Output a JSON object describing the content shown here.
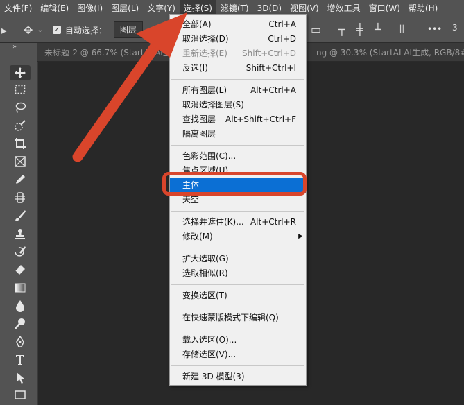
{
  "menubar": {
    "items": [
      "文件(F)",
      "编辑(E)",
      "图像(I)",
      "图层(L)",
      "文字(Y)",
      "选择(S)",
      "滤镜(T)",
      "3D(D)",
      "视图(V)",
      "增效工具",
      "窗口(W)",
      "帮助(H)"
    ],
    "active_index": 5
  },
  "options_bar": {
    "auto_select_label": "自动选择：",
    "layer_select_value": "图层",
    "more_label": "•••"
  },
  "document_tabs": {
    "tab1": "未标题-2 @ 66.7% (StartAI AI生成,",
    "tab2": "ng @ 30.3% (StartAI AI生成, RGB/8#) *"
  },
  "select_menu": {
    "items": [
      {
        "label": "全部(A)",
        "shortcut": "Ctrl+A",
        "disabled": false
      },
      {
        "label": "取消选择(D)",
        "shortcut": "Ctrl+D",
        "disabled": false
      },
      {
        "label": "重新选择(E)",
        "shortcut": "Shift+Ctrl+D",
        "disabled": true
      },
      {
        "label": "反选(I)",
        "shortcut": "Shift+Ctrl+I",
        "disabled": false
      },
      {
        "label": "所有图层(L)",
        "shortcut": "Alt+Ctrl+A",
        "disabled": false
      },
      {
        "label": "取消选择图层(S)",
        "shortcut": "",
        "disabled": false
      },
      {
        "label": "查找图层",
        "shortcut": "Alt+Shift+Ctrl+F",
        "disabled": false
      },
      {
        "label": "隔离图层",
        "shortcut": "",
        "disabled": false
      },
      {
        "label": "色彩范围(C)...",
        "shortcut": "",
        "disabled": false
      },
      {
        "label": "焦点区域(U)...",
        "shortcut": "",
        "disabled": false
      },
      {
        "label": "主体",
        "shortcut": "",
        "disabled": false,
        "highlighted": true
      },
      {
        "label": "天空",
        "shortcut": "",
        "disabled": false
      },
      {
        "label": "选择并遮住(K)...",
        "shortcut": "Alt+Ctrl+R",
        "disabled": false
      },
      {
        "label": "修改(M)",
        "shortcut": "",
        "disabled": false
      },
      {
        "label": "扩大选取(G)",
        "shortcut": "",
        "disabled": false
      },
      {
        "label": "选取相似(R)",
        "shortcut": "",
        "disabled": false
      },
      {
        "label": "变换选区(T)",
        "shortcut": "",
        "disabled": false
      },
      {
        "label": "在快速蒙版模式下编辑(Q)",
        "shortcut": "",
        "disabled": false
      },
      {
        "label": "载入选区(O)...",
        "shortcut": "",
        "disabled": false
      },
      {
        "label": "存储选区(V)...",
        "shortcut": "",
        "disabled": false
      },
      {
        "label": "新建 3D 模型(3)",
        "shortcut": "",
        "disabled": false
      }
    ]
  },
  "colors": {
    "highlight_annotation": "#d9452b",
    "menu_selected": "#0b6fd4",
    "active_menu_underline": "#1473e6"
  },
  "tools": [
    "move-tool",
    "marquee-tool",
    "lasso-tool",
    "quick-selection-tool",
    "crop-tool",
    "frame-tool",
    "eyedropper-tool",
    "healing-brush-tool",
    "brush-tool",
    "clone-stamp-tool",
    "history-brush-tool",
    "eraser-tool",
    "gradient-tool",
    "blur-tool",
    "dodge-tool",
    "pen-tool",
    "type-tool",
    "path-selection-tool",
    "rectangle-tool"
  ]
}
